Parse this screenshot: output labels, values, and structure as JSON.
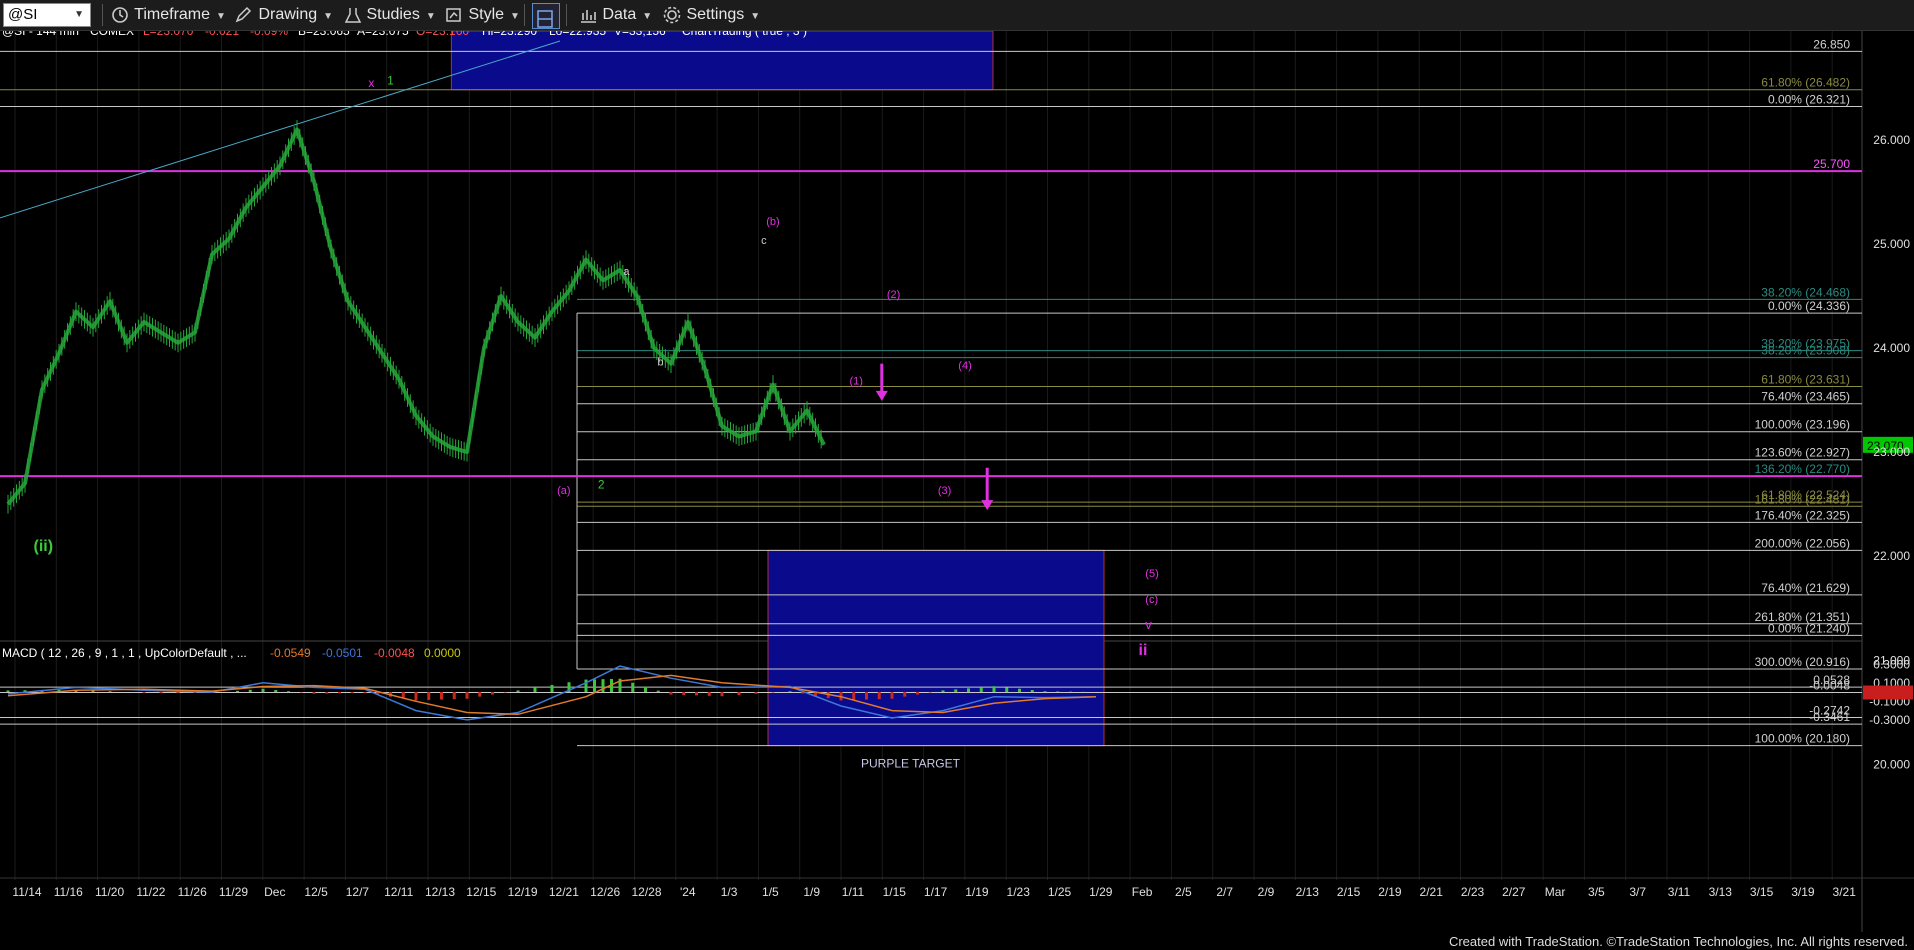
{
  "toolbar": {
    "symbol": "@SI",
    "timeframe_label": "Timeframe",
    "drawing_label": "Drawing",
    "studies_label": "Studies",
    "style_label": "Style",
    "data_label": "Data",
    "settings_label": "Settings"
  },
  "status": {
    "symbol": "@SI - 144 min",
    "exchange": "COMEX",
    "last": "L=23.070",
    "change": "-0.021",
    "change_pct": "-0.09%",
    "bid": "B=23.065",
    "ask": "A=23.075",
    "open": "O=23.160",
    "high": "Hi=23.290",
    "low": "Lo=22.935",
    "volume": "V=33,156",
    "study": "ChartTrading ( true , 3 )"
  },
  "macd_header": {
    "label": "MACD ( 12 , 26 , 9 , 1 , 1 , UpColorDefault , ...",
    "v1": "-0.0549",
    "v2": "-0.0501",
    "v3": "-0.0048",
    "v4": "0.0000"
  },
  "colors": {
    "price": "#26a83a",
    "magenta": "#e030e0",
    "target_box": "#0a0a8c",
    "macd_line": "#3c78d8",
    "signal_line": "#e07a2c",
    "hist_up": "#3cc83c",
    "hist_down": "#c8281e",
    "last_price_tag": "#00c800"
  },
  "chart_data": {
    "type": "line",
    "symbol": "@SI",
    "timeframe": "144 min",
    "price_ticks": [
      "26.000",
      "25.000",
      "24.000",
      "23.000",
      "22.000",
      "21.000",
      "20.000"
    ],
    "ylim": [
      19.85,
      26.95
    ],
    "macd_ticks": [
      "0.3000",
      "0.1000",
      "-0.1000",
      "-0.3000"
    ],
    "macd_ylim": [
      -0.42,
      0.4
    ],
    "x_labels": [
      "11/14",
      "11/16",
      "11/20",
      "11/22",
      "11/26",
      "11/29",
      "Dec",
      "12/5",
      "12/7",
      "12/11",
      "12/13",
      "12/15",
      "12/19",
      "12/21",
      "12/26",
      "12/28",
      "'24",
      "1/3",
      "1/5",
      "1/9",
      "1/11",
      "1/15",
      "1/17",
      "1/19",
      "1/23",
      "1/25",
      "1/29",
      "Feb",
      "2/5",
      "2/7",
      "2/9",
      "2/13",
      "2/15",
      "2/19",
      "2/21",
      "2/23",
      "2/27",
      "Mar",
      "3/5",
      "3/7",
      "3/11",
      "3/13",
      "3/15",
      "3/19",
      "3/21"
    ],
    "price_path": [
      {
        "x": 0,
        "y": 22.5
      },
      {
        "x": 1,
        "y": 22.7
      },
      {
        "x": 2,
        "y": 23.6
      },
      {
        "x": 3,
        "y": 23.95
      },
      {
        "x": 4,
        "y": 24.35
      },
      {
        "x": 5,
        "y": 24.2
      },
      {
        "x": 6,
        "y": 24.45
      },
      {
        "x": 7,
        "y": 24.05
      },
      {
        "x": 8,
        "y": 24.25
      },
      {
        "x": 9,
        "y": 24.15
      },
      {
        "x": 10,
        "y": 24.05
      },
      {
        "x": 11,
        "y": 24.15
      },
      {
        "x": 12,
        "y": 24.9
      },
      {
        "x": 13,
        "y": 25.05
      },
      {
        "x": 14,
        "y": 25.35
      },
      {
        "x": 15,
        "y": 25.55
      },
      {
        "x": 16,
        "y": 25.75
      },
      {
        "x": 17,
        "y": 26.1
      },
      {
        "x": 18,
        "y": 25.6
      },
      {
        "x": 19,
        "y": 24.95
      },
      {
        "x": 20,
        "y": 24.45
      },
      {
        "x": 21,
        "y": 24.2
      },
      {
        "x": 22,
        "y": 23.95
      },
      {
        "x": 23,
        "y": 23.7
      },
      {
        "x": 24,
        "y": 23.35
      },
      {
        "x": 25,
        "y": 23.15
      },
      {
        "x": 26,
        "y": 23.05
      },
      {
        "x": 27,
        "y": 23.0
      },
      {
        "x": 28,
        "y": 24.0
      },
      {
        "x": 29,
        "y": 24.5
      },
      {
        "x": 30,
        "y": 24.25
      },
      {
        "x": 31,
        "y": 24.1
      },
      {
        "x": 32,
        "y": 24.35
      },
      {
        "x": 33,
        "y": 24.55
      },
      {
        "x": 34,
        "y": 24.85
      },
      {
        "x": 35,
        "y": 24.65
      },
      {
        "x": 36,
        "y": 24.75
      },
      {
        "x": 37,
        "y": 24.5
      },
      {
        "x": 38,
        "y": 24.0
      },
      {
        "x": 39,
        "y": 23.85
      },
      {
        "x": 40,
        "y": 24.25
      },
      {
        "x": 41,
        "y": 23.8
      },
      {
        "x": 42,
        "y": 23.25
      },
      {
        "x": 43,
        "y": 23.15
      },
      {
        "x": 44,
        "y": 23.2
      },
      {
        "x": 45,
        "y": 23.65
      },
      {
        "x": 46,
        "y": 23.2
      },
      {
        "x": 47,
        "y": 23.4
      },
      {
        "x": 48,
        "y": 23.07
      }
    ],
    "x_count": 115,
    "horizontal_levels": [
      {
        "value": 26.85,
        "label": "26.850",
        "color": "#c8c8c8"
      },
      {
        "value": 26.482,
        "label": "61.80% (26.482)",
        "color": "#8a8a40"
      },
      {
        "value": 26.321,
        "label": "0.00% (26.321)",
        "color": "#c8c8c8"
      },
      {
        "value": 25.7,
        "label": "25.700",
        "color": "#e030e0"
      },
      {
        "value": 24.468,
        "label": "38.20% (24.468)",
        "color": "#2a8a80"
      },
      {
        "value": 24.336,
        "label": "0.00% (24.336)",
        "color": "#c8c8c8"
      },
      {
        "value": 23.975,
        "label": "38.20% (23.975)",
        "color": "#2a8a80"
      },
      {
        "value": 23.908,
        "label": "38.20% (23.908)",
        "color": "#2a8a80"
      },
      {
        "value": 23.631,
        "label": "61.80% (23.631)",
        "color": "#8a8a40"
      },
      {
        "value": 23.465,
        "label": "76.40% (23.465)",
        "color": "#c8c8c8"
      },
      {
        "value": 23.196,
        "label": "100.00% (23.196)",
        "color": "#c8c8c8"
      },
      {
        "value": 22.927,
        "label": "123.60% (22.927)",
        "color": "#c8c8c8"
      },
      {
        "value": 22.77,
        "label": "136.20% (22.770)",
        "color": "#2a8a80"
      },
      {
        "value": 22.52,
        "label": "61.80% (22.524)",
        "color": "#8a8a40"
      },
      {
        "value": 22.48,
        "label": "161.80% (22.481)",
        "color": "#8a8a40"
      },
      {
        "value": 22.325,
        "label": "176.40% (22.325)",
        "color": "#c8c8c8"
      },
      {
        "value": 22.056,
        "label": "200.00% (22.056)",
        "color": "#c8c8c8"
      },
      {
        "value": 21.629,
        "label": "76.40% (21.629)",
        "color": "#c8c8c8"
      },
      {
        "value": 21.351,
        "label": "261.80% (21.351)",
        "color": "#c8c8c8"
      },
      {
        "value": 21.24,
        "label": "0.00% (21.240)",
        "color": "#c8c8c8"
      },
      {
        "value": 20.916,
        "label": "300.00% (20.916)",
        "color": "#c8c8c8"
      },
      {
        "value": 20.18,
        "label": "100.00% (20.180)",
        "color": "#c8c8c8"
      }
    ],
    "magenta_support": 22.77,
    "right_axis_value": "23.070",
    "macd_levels": [
      {
        "value": 0.0528,
        "label": "0.0528"
      },
      {
        "value": -0.0048,
        "label": "-0.0048"
      },
      {
        "value": -0.2742,
        "label": "-0.2742"
      },
      {
        "value": -0.3461,
        "label": "-0.3461"
      }
    ],
    "target_box": {
      "x_from": 57.3,
      "x_to": 82.5,
      "y_from": 20.18,
      "y_to": 22.056,
      "label": "PURPLE TARGET"
    },
    "top_box": {
      "x_from": 21,
      "x_to": 60,
      "y_from": 26.482,
      "y_to": 26.95
    },
    "wave_labels": [
      {
        "text": "(ii)",
        "x": 1.5,
        "y": 22.05,
        "color": "#3cc83c",
        "size": 16
      },
      {
        "text": "x",
        "x": 21.2,
        "y": 26.51,
        "color": "#e030e0",
        "size": 12
      },
      {
        "text": "1",
        "x": 22.3,
        "y": 26.53,
        "color": "#3cc83c",
        "size": 12
      },
      {
        "text": "a",
        "x": 36.2,
        "y": 24.7,
        "color": "#c8c8c8",
        "size": 11
      },
      {
        "text": "b",
        "x": 38.2,
        "y": 23.83,
        "color": "#c8c8c8",
        "size": 11
      },
      {
        "text": "c",
        "x": 44.3,
        "y": 25.0,
        "color": "#c8c8c8",
        "size": 11
      },
      {
        "text": "(b)",
        "x": 44.6,
        "y": 25.18,
        "color": "#e030e0",
        "size": 11
      },
      {
        "text": "(a)",
        "x": 32.3,
        "y": 22.6,
        "color": "#e030e0",
        "size": 11
      },
      {
        "text": "2",
        "x": 34.7,
        "y": 22.65,
        "color": "#3cc83c",
        "size": 12
      },
      {
        "text": "(2)",
        "x": 51.7,
        "y": 24.48,
        "color": "#e030e0",
        "size": 11
      },
      {
        "text": "(1)",
        "x": 49.5,
        "y": 23.65,
        "color": "#e030e0",
        "size": 11
      },
      {
        "text": "(4)",
        "x": 55.9,
        "y": 23.8,
        "color": "#e030e0",
        "size": 11
      },
      {
        "text": "(3)",
        "x": 54.7,
        "y": 22.6,
        "color": "#e030e0",
        "size": 11
      },
      {
        "text": "(5)",
        "x": 66.9,
        "y": 21.8,
        "color": "#e030e0",
        "size": 11
      },
      {
        "text": "(c)",
        "x": 66.9,
        "y": 21.55,
        "color": "#e030e0",
        "size": 11
      },
      {
        "text": "v",
        "x": 66.9,
        "y": 21.3,
        "color": "#e030e0",
        "size": 13
      },
      {
        "text": "ii",
        "x": 66.5,
        "y": 21.05,
        "color": "#e030e0",
        "size": 16
      }
    ],
    "arrows": [
      {
        "x": 51.4,
        "from": 23.85,
        "to": 23.55
      },
      {
        "x": 57.6,
        "from": 22.85,
        "to": 22.5
      }
    ],
    "trendline": {
      "x1": 0,
      "y1": 25.25,
      "x2": 42,
      "y2": 26.95
    },
    "macd_line": [
      {
        "x": 0,
        "y": -0.02
      },
      {
        "x": 4,
        "y": 0.05
      },
      {
        "x": 8,
        "y": 0.02
      },
      {
        "x": 12,
        "y": 0.0
      },
      {
        "x": 15,
        "y": 0.1
      },
      {
        "x": 18,
        "y": 0.05
      },
      {
        "x": 21,
        "y": 0.03
      },
      {
        "x": 24,
        "y": -0.2
      },
      {
        "x": 27,
        "y": -0.3
      },
      {
        "x": 30,
        "y": -0.22
      },
      {
        "x": 34,
        "y": 0.1
      },
      {
        "x": 36,
        "y": 0.28
      },
      {
        "x": 39,
        "y": 0.15
      },
      {
        "x": 42,
        "y": 0.05
      },
      {
        "x": 46,
        "y": 0.06
      },
      {
        "x": 49,
        "y": -0.15
      },
      {
        "x": 52,
        "y": -0.28
      },
      {
        "x": 55,
        "y": -0.2
      },
      {
        "x": 58,
        "y": -0.05
      },
      {
        "x": 61,
        "y": -0.06
      },
      {
        "x": 64,
        "y": -0.05
      }
    ],
    "signal_line": [
      {
        "x": 0,
        "y": -0.04
      },
      {
        "x": 4,
        "y": 0.02
      },
      {
        "x": 8,
        "y": 0.03
      },
      {
        "x": 12,
        "y": 0.01
      },
      {
        "x": 15,
        "y": 0.06
      },
      {
        "x": 18,
        "y": 0.07
      },
      {
        "x": 21,
        "y": 0.04
      },
      {
        "x": 24,
        "y": -0.1
      },
      {
        "x": 27,
        "y": -0.22
      },
      {
        "x": 30,
        "y": -0.24
      },
      {
        "x": 34,
        "y": -0.05
      },
      {
        "x": 36,
        "y": 0.12
      },
      {
        "x": 39,
        "y": 0.18
      },
      {
        "x": 42,
        "y": 0.1
      },
      {
        "x": 46,
        "y": 0.05
      },
      {
        "x": 49,
        "y": -0.05
      },
      {
        "x": 52,
        "y": -0.2
      },
      {
        "x": 55,
        "y": -0.22
      },
      {
        "x": 58,
        "y": -0.12
      },
      {
        "x": 61,
        "y": -0.07
      },
      {
        "x": 64,
        "y": -0.05
      }
    ]
  },
  "footer": "Created with TradeStation. ©TradeStation Technologies, Inc. All rights reserved."
}
